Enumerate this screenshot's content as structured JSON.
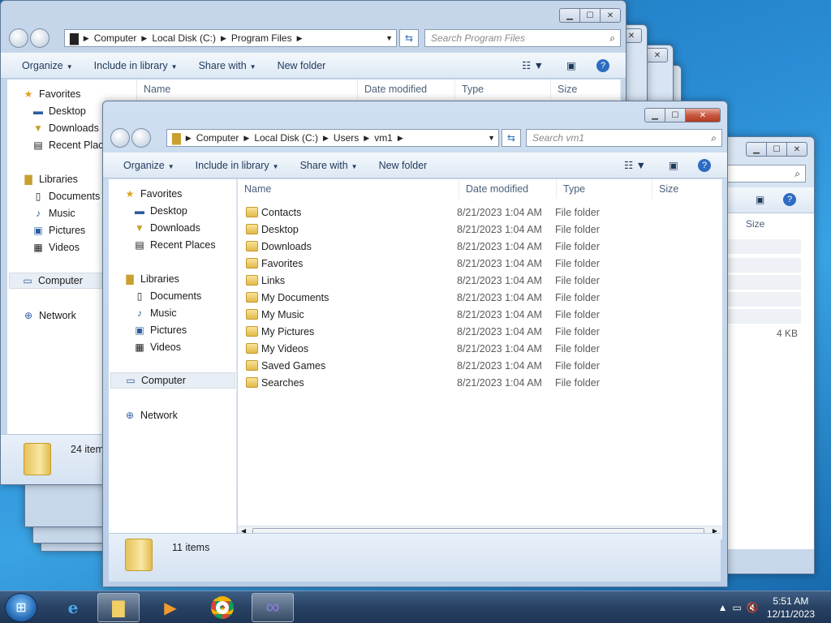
{
  "colors": {
    "desktop": "#2b8ed6",
    "taskbar": "#2a4466",
    "close": "#c75a41"
  },
  "back_window_a": {
    "address": [
      "Computer",
      "Local Disk (C:)",
      "Program Files"
    ],
    "search_placeholder": "Search Program Files",
    "toolbar": {
      "organize": "Organize",
      "include": "Include in library",
      "share": "Share with",
      "new_folder": "New folder"
    },
    "columns": {
      "name": "Name",
      "date": "Date modified",
      "type": "Type",
      "size": "Size"
    },
    "nav": {
      "favorites": "Favorites",
      "desktop": "Desktop",
      "downloads": "Downloads",
      "recent": "Recent Places",
      "libraries": "Libraries",
      "documents": "Documents",
      "music": "Music",
      "pictures": "Pictures",
      "videos": "Videos",
      "computer": "Computer",
      "network": "Network"
    },
    "status": "24 items"
  },
  "back_window_b": {
    "columns": {
      "size": "Size"
    },
    "size_value": "4 KB"
  },
  "main_window": {
    "address": [
      "Computer",
      "Local Disk (C:)",
      "Users",
      "vm1"
    ],
    "search_placeholder": "Search vm1",
    "toolbar": {
      "organize": "Organize",
      "include": "Include in library",
      "share": "Share with",
      "new_folder": "New folder"
    },
    "columns": {
      "name": "Name",
      "date": "Date modified",
      "type": "Type",
      "size": "Size"
    },
    "nav": {
      "favorites": "Favorites",
      "desktop": "Desktop",
      "downloads": "Downloads",
      "recent": "Recent Places",
      "libraries": "Libraries",
      "documents": "Documents",
      "music": "Music",
      "pictures": "Pictures",
      "videos": "Videos",
      "computer": "Computer",
      "network": "Network"
    },
    "files": [
      {
        "name": "Contacts",
        "date": "8/21/2023 1:04 AM",
        "type": "File folder"
      },
      {
        "name": "Desktop",
        "date": "8/21/2023 1:04 AM",
        "type": "File folder"
      },
      {
        "name": "Downloads",
        "date": "8/21/2023 1:04 AM",
        "type": "File folder"
      },
      {
        "name": "Favorites",
        "date": "8/21/2023 1:04 AM",
        "type": "File folder"
      },
      {
        "name": "Links",
        "date": "8/21/2023 1:04 AM",
        "type": "File folder"
      },
      {
        "name": "My Documents",
        "date": "8/21/2023 1:04 AM",
        "type": "File folder"
      },
      {
        "name": "My Music",
        "date": "8/21/2023 1:04 AM",
        "type": "File folder"
      },
      {
        "name": "My Pictures",
        "date": "8/21/2023 1:04 AM",
        "type": "File folder"
      },
      {
        "name": "My Videos",
        "date": "8/21/2023 1:04 AM",
        "type": "File folder"
      },
      {
        "name": "Saved Games",
        "date": "8/21/2023 1:04 AM",
        "type": "File folder"
      },
      {
        "name": "Searches",
        "date": "8/21/2023 1:04 AM",
        "type": "File folder"
      }
    ],
    "status": "11 items"
  },
  "taskbar": {
    "apps": [
      "start-orb",
      "internet-explorer",
      "windows-explorer",
      "media-player",
      "chrome",
      "visual-studio"
    ],
    "time": "5:51 AM",
    "date": "12/11/2023"
  }
}
